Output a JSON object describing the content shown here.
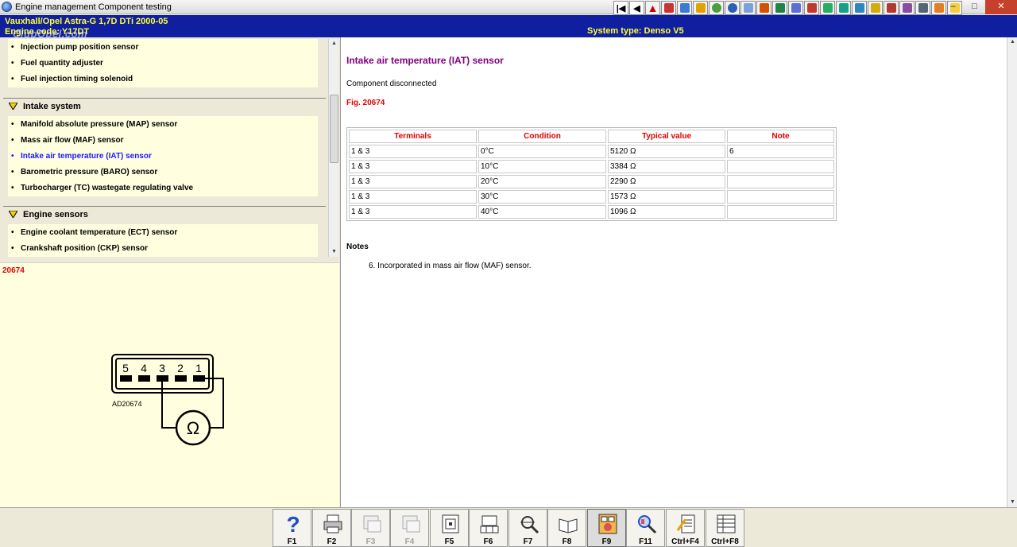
{
  "window": {
    "title": "Engine management Component testing",
    "buttons": [
      "–",
      "□",
      "✕"
    ]
  },
  "header": {
    "vehicle": "Vauxhall/Opel  Astra-G  1,7D DTi 2000-05",
    "engine": "Engine code: Y17DT",
    "system_type": "System type: Denso V5",
    "watermark": "ClubOpel.com"
  },
  "toolbar": {
    "icons": [
      "first-icon",
      "previous-icon",
      "warning-icon",
      "data-icon",
      "tools-icon",
      "service-icon",
      "tyre-icon",
      "wiring-icon",
      "battery-icon",
      "lighting-icon",
      "fuse-icon",
      "repair-icon",
      "engine-icon",
      "electrics-icon",
      "ecu-icon",
      "gearbox-icon",
      "steering-icon",
      "brakes-icon",
      "diagnostics-icon",
      "airbag-icon",
      "aircon-icon",
      "info-icon"
    ]
  },
  "tree": {
    "fuel_items": [
      {
        "label": "Injection pump position sensor",
        "active": false
      },
      {
        "label": "Fuel quantity adjuster",
        "active": false
      },
      {
        "label": "Fuel injection timing solenoid",
        "active": false
      }
    ],
    "intake": {
      "label": "Intake system",
      "items": [
        {
          "label": "Manifold absolute pressure (MAP) sensor",
          "active": false
        },
        {
          "label": "Mass air flow (MAF) sensor",
          "active": false
        },
        {
          "label": "Intake air temperature (IAT) sensor",
          "active": true
        },
        {
          "label": "Barometric pressure (BARO) sensor",
          "active": false
        },
        {
          "label": "Turbocharger (TC) wastegate regulating valve",
          "active": false
        }
      ]
    },
    "engine_sensors": {
      "label": "Engine sensors",
      "items": [
        {
          "label": "Engine coolant temperature (ECT) sensor",
          "active": false
        },
        {
          "label": "Crankshaft position (CKP) sensor",
          "active": false
        }
      ]
    }
  },
  "figure": {
    "number": "20674",
    "connector_pins": [
      "5",
      "4",
      "3",
      "2",
      "1"
    ],
    "diagram_label": "AD20674",
    "meter_symbol": "Ω"
  },
  "content": {
    "title": "Intake air temperature (IAT) sensor",
    "status": "Component disconnected",
    "fig_label": "Fig. 20674",
    "table": {
      "headers": [
        "Terminals",
        "Condition",
        "Typical value",
        "Note"
      ],
      "rows": [
        [
          "1 & 3",
          "0°C",
          "5120 Ω",
          "6"
        ],
        [
          "1 & 3",
          "10°C",
          "3384 Ω",
          ""
        ],
        [
          "1 & 3",
          "20°C",
          "2290 Ω",
          ""
        ],
        [
          "1 & 3",
          "30°C",
          "1573 Ω",
          ""
        ],
        [
          "1 & 3",
          "40°C",
          "1096 Ω",
          ""
        ]
      ]
    },
    "notes_title": "Notes",
    "notes": [
      "6. Incorporated in mass air flow (MAF) sensor."
    ]
  },
  "fkeys": [
    {
      "label": "F1",
      "icon": "help-icon",
      "disabled": false,
      "pressed": false
    },
    {
      "label": "F2",
      "icon": "print-icon",
      "disabled": false,
      "pressed": false
    },
    {
      "label": "F3",
      "icon": "component-icon",
      "disabled": true,
      "pressed": false
    },
    {
      "label": "F4",
      "icon": "component-data-icon",
      "disabled": true,
      "pressed": false
    },
    {
      "label": "F5",
      "icon": "ecu-pinout-icon",
      "disabled": false,
      "pressed": false
    },
    {
      "label": "F6",
      "icon": "connector-icon",
      "disabled": false,
      "pressed": false
    },
    {
      "label": "F7",
      "icon": "component-location-icon",
      "disabled": false,
      "pressed": false
    },
    {
      "label": "F8",
      "icon": "manual-icon",
      "disabled": false,
      "pressed": false
    },
    {
      "label": "F9",
      "icon": "test-values-icon",
      "disabled": false,
      "pressed": true
    },
    {
      "label": "F11",
      "icon": "search-icon",
      "disabled": false,
      "pressed": false
    },
    {
      "label": "Ctrl+F4",
      "icon": "notes-icon",
      "disabled": false,
      "pressed": false
    },
    {
      "label": "Ctrl+F8",
      "icon": "list-icon",
      "disabled": false,
      "pressed": false
    }
  ]
}
